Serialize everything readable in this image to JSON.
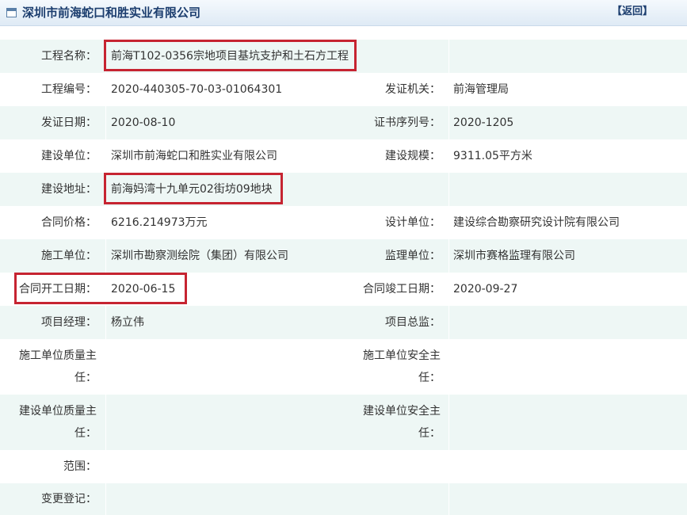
{
  "header": {
    "title": "深圳市前海蛇口和胜实业有限公司",
    "back_label": "【返回】"
  },
  "rows": [
    {
      "label1": "工程名称：",
      "value1": "前海T102-0356宗地项目基坑支护和土石方工程"
    },
    {
      "label1": "工程编号：",
      "value1": "2020-440305-70-03-01064301",
      "label2": "发证机关：",
      "value2": "前海管理局"
    },
    {
      "label1": "发证日期：",
      "value1": "2020-08-10",
      "label2": "证书序列号：",
      "value2": "2020-1205"
    },
    {
      "label1": "建设单位：",
      "value1": "深圳市前海蛇口和胜实业有限公司",
      "label2": "建设规模：",
      "value2": "9311.05平方米"
    },
    {
      "label1": "建设地址：",
      "value1": "前海妈湾十九单元02街坊09地块"
    },
    {
      "label1": "合同价格：",
      "value1": "6216.214973万元",
      "label2": "设计单位：",
      "value2": "建设综合勘察研究设计院有限公司"
    },
    {
      "label1": "施工单位：",
      "value1": "深圳市勘察测绘院（集团）有限公司",
      "label2": "监理单位：",
      "value2": "深圳市赛格监理有限公司"
    },
    {
      "label1": "合同开工日期：",
      "value1": "2020-06-15",
      "label2": "合同竣工日期：",
      "value2": "2020-09-27"
    },
    {
      "label1": "项目经理：",
      "value1": "杨立伟",
      "label2": "项目总监：",
      "value2": ""
    },
    {
      "label1_a": "施工单位质量主",
      "label1_b": "任：",
      "value1": "",
      "label2_a": "施工单位安全主",
      "label2_b": "任：",
      "value2": ""
    },
    {
      "label1_a": "建设单位质量主",
      "label1_b": "任：",
      "value1": "",
      "label2_a": "建设单位安全主",
      "label2_b": "任：",
      "value2": ""
    },
    {
      "label1": "范围：",
      "value1": ""
    },
    {
      "label1": "变更登记：",
      "value1": ""
    }
  ],
  "colors": {
    "row_shade": "#eef7f5",
    "highlight": "#c62431",
    "title_text": "#1b3d6e"
  }
}
